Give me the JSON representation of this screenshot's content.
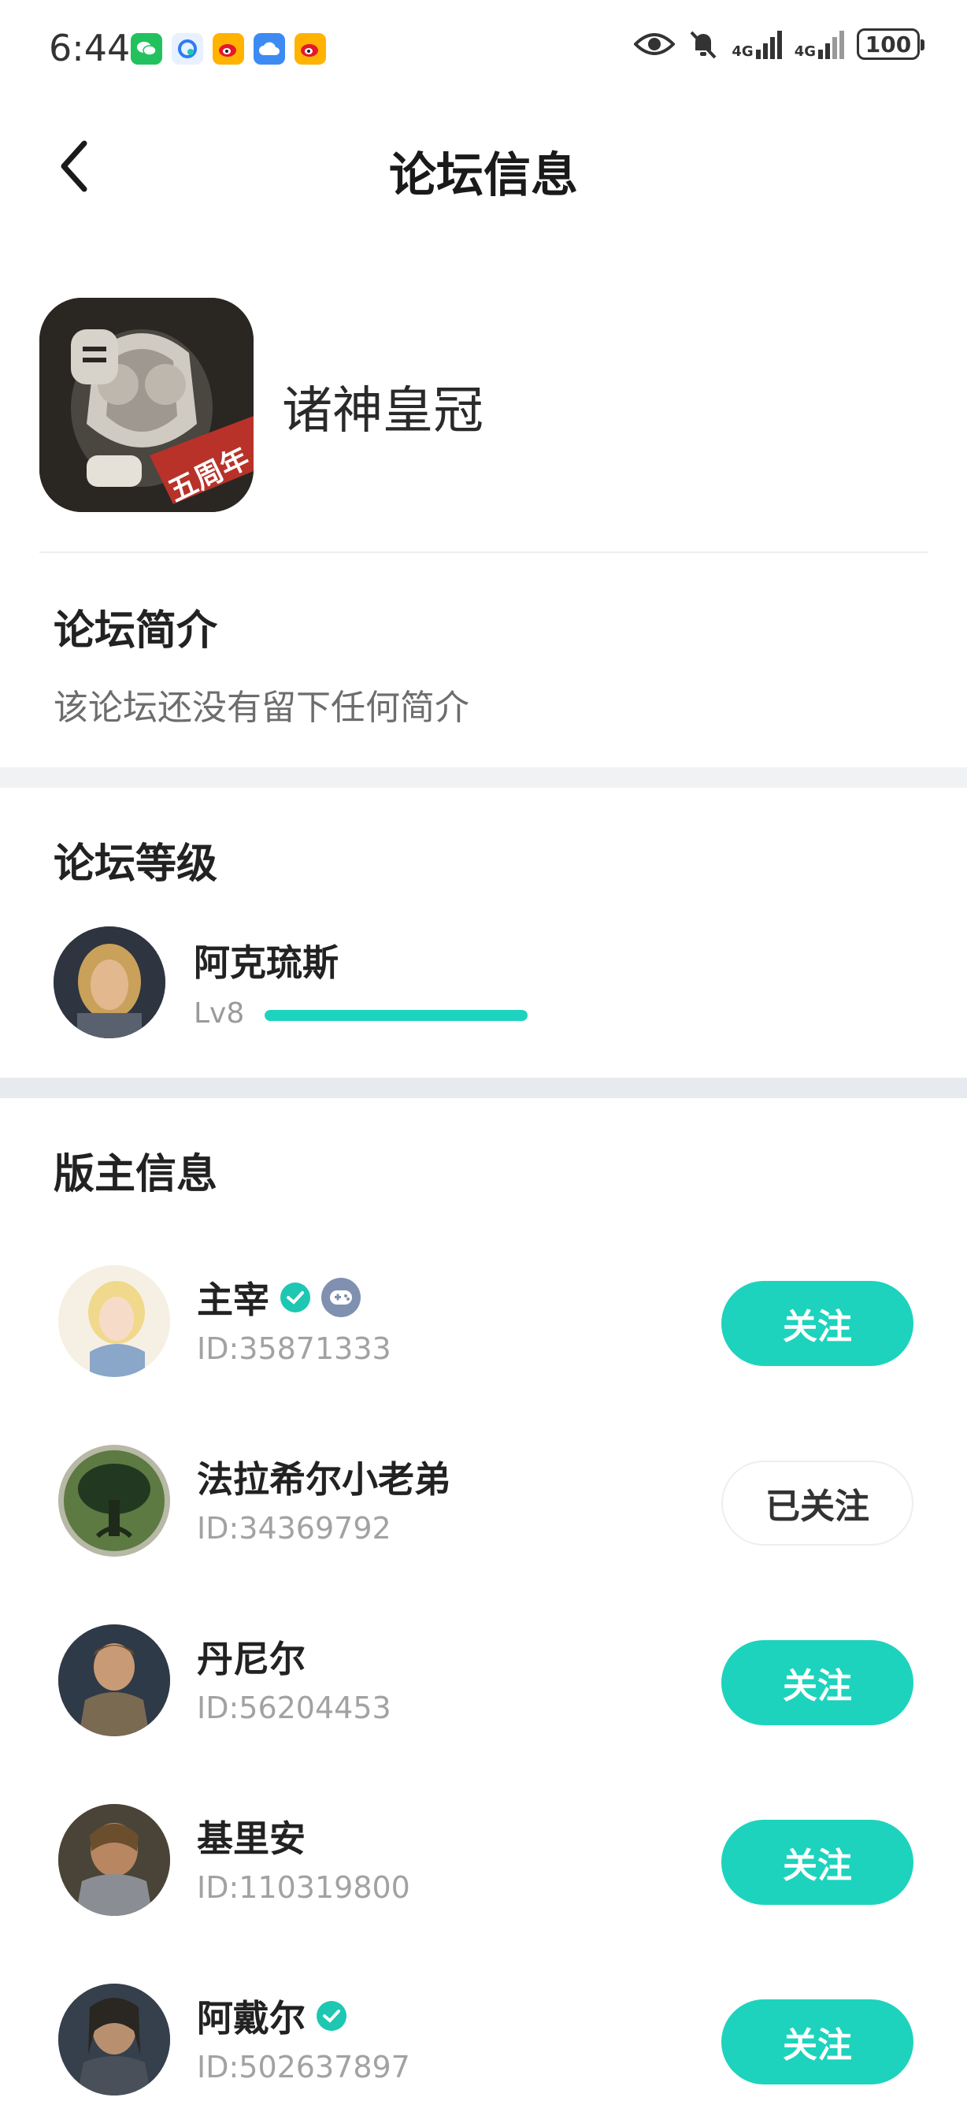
{
  "status_bar": {
    "time": "6:44",
    "network_1": "4G",
    "network_2": "4G",
    "battery": "100",
    "app_icons": [
      "wechat-icon",
      "qq-browser-icon",
      "weibo-icon",
      "cloud-icon",
      "weibo-icon"
    ],
    "system_icons": [
      "eye-icon",
      "mute-icon",
      "signal-icon",
      "signal-icon",
      "battery-icon"
    ]
  },
  "header": {
    "title": "论坛信息",
    "back_icon": "chevron-left-icon"
  },
  "forum": {
    "name": "诸神皇冠",
    "avatar_badge": "五周年"
  },
  "intro": {
    "title": "论坛简介",
    "text": "该论坛还没有留下任何简介"
  },
  "level": {
    "title": "论坛等级",
    "name": "阿克琉斯",
    "lv": "Lv8",
    "progress": 1.0,
    "accent": "#1dd3bd"
  },
  "moderators": {
    "title": "版主信息",
    "items": [
      {
        "name": "主宰",
        "id": "ID:35871333",
        "button": "关注",
        "followed": false,
        "verified": true,
        "role_badge": true
      },
      {
        "name": "法拉希尔小老弟",
        "id": "ID:34369792",
        "button": "已关注",
        "followed": true,
        "verified": false,
        "role_badge": false
      },
      {
        "name": "丹尼尔",
        "id": "ID:56204453",
        "button": "关注",
        "followed": false,
        "verified": false,
        "role_badge": false
      },
      {
        "name": "基里安",
        "id": "ID:110319800",
        "button": "关注",
        "followed": false,
        "verified": false,
        "role_badge": false
      },
      {
        "name": "阿戴尔",
        "id": "ID:502637897",
        "button": "关注",
        "followed": false,
        "verified": true,
        "role_badge": false
      }
    ]
  },
  "colors": {
    "accent": "#1dd3bd",
    "background_band": "#f0f2f4"
  }
}
